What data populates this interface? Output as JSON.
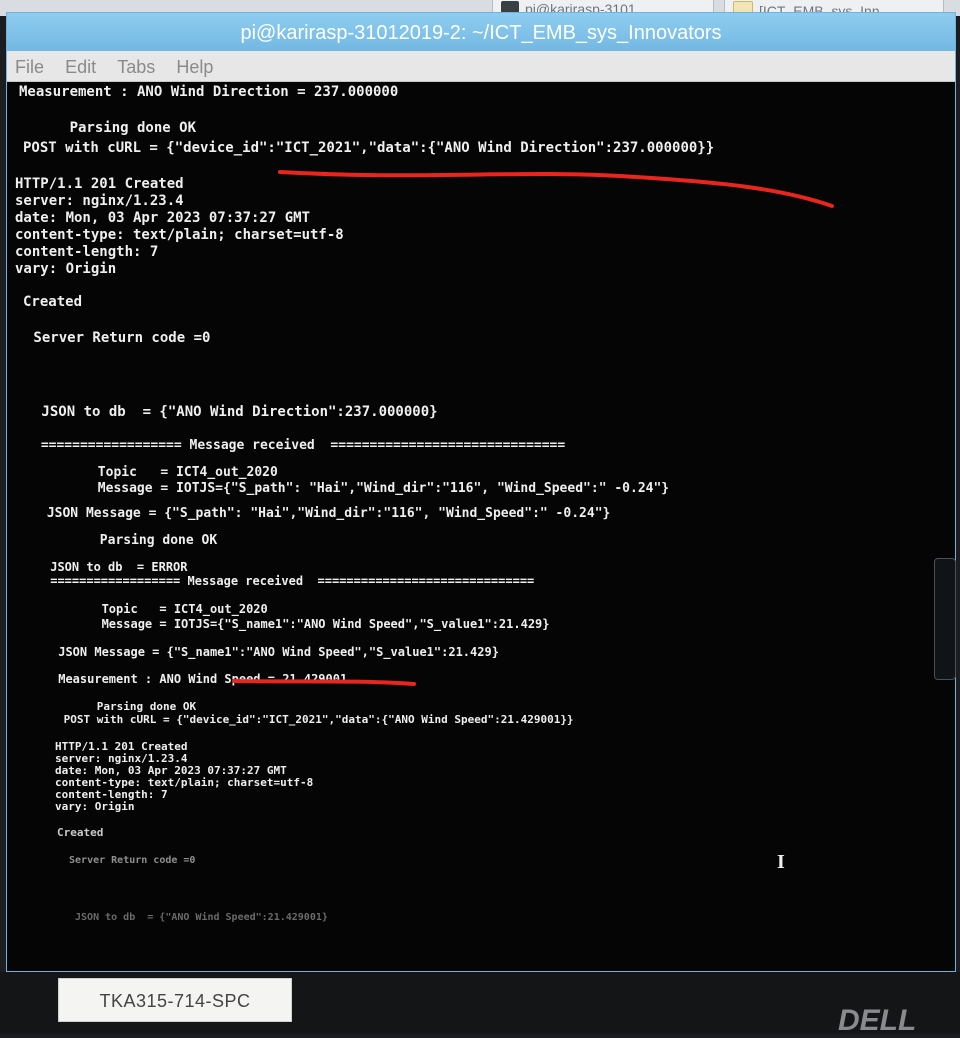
{
  "taskbar": {
    "tab1": "pi@karirasp-3101...",
    "tab2": "[ICT_EMB_sys_Inn..."
  },
  "window": {
    "title": "pi@karirasp-31012019-2: ~/ICT_EMB_sys_Innovators",
    "menu": [
      "File",
      "Edit",
      "Tabs",
      "Help"
    ]
  },
  "terminal": {
    "lines": [
      "Measurement : ANO Wind Direction = 237.000000",
      "",
      "      Parsing done OK",
      "POST with cURL = {\"device_id\":\"ICT_2021\",\"data\":{\"ANO Wind Direction\":237.000000}}",
      "",
      "HTTP/1.1 201 Created",
      "server: nginx/1.23.4",
      "date: Mon, 03 Apr 2023 07:37:27 GMT",
      "content-type: text/plain; charset=utf-8",
      "content-length: 7",
      "vary: Origin",
      "",
      "Created",
      "",
      " Server Return code =0",
      "",
      "",
      "",
      " JSON to db  = {\"ANO Wind Direction\":237.000000}",
      "",
      " ================== Message received  ==============================",
      "",
      "       Topic   = ICT4_out_2020",
      "       Message = IOTJS={\"S_path\": \"Hai\",\"Wind_dir\":\"116\", \"Wind_Speed\":\" -0.24\"}",
      "",
      " JSON Message = {\"S_path\": \"Hai\",\"Wind_dir\":\"116\", \"Wind_Speed\":\" -0.24\"}",
      "",
      "       Parsing done OK",
      "",
      " JSON to db  = ERROR",
      " ================== Message received  ==============================",
      "",
      "       Topic   = ICT4_out_2020",
      "       Message = IOTJS={\"S_name1\":\"ANO Wind Speed\",\"S_value1\":21.429}",
      "",
      " JSON Message = {\"S_name1\":\"ANO Wind Speed\",\"S_value1\":21.429}",
      "",
      " Measurement : ANO Wind Speed = 21.429001",
      "",
      "      Parsing done OK",
      " POST with cURL = {\"device_id\":\"ICT_2021\",\"data\":{\"ANO Wind Speed\":21.429001}}",
      "",
      "HTTP/1.1 201 Created",
      "server: nginx/1.23.4",
      "date: Mon, 03 Apr 2023 07:37:27 GMT",
      "content-type: text/plain; charset=utf-8",
      "content-length: 7",
      "vary: Origin",
      "",
      "Created",
      "",
      " Server Return code =0",
      "",
      "",
      "",
      " JSON to db  = {\"ANO Wind Speed\":21.429001}"
    ]
  },
  "bezel": {
    "asset_label": "TKA315-714-SPC",
    "brand": "DELL"
  },
  "colors": {
    "terminal_bg": "#050505",
    "terminal_fg": "#efefef",
    "titlebar": "#7fc2e8",
    "annotation_red": "#e8261e"
  }
}
